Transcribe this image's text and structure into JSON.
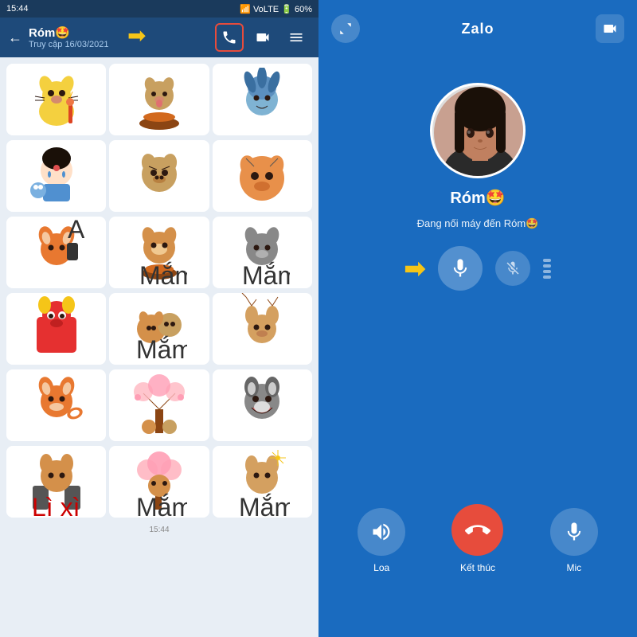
{
  "left": {
    "status_bar": {
      "time": "15:44",
      "battery": "60%",
      "signal": "VoLTE"
    },
    "header": {
      "name": "Róm🤩",
      "sub": "Truy cập 16/03/2021",
      "back_label": "←"
    },
    "stickers": [
      {
        "emoji": "🐕",
        "label": ""
      },
      {
        "emoji": "🦮",
        "label": ""
      },
      {
        "emoji": "🐻",
        "label": ""
      },
      {
        "emoji": "👧",
        "label": ""
      },
      {
        "emoji": "🐶",
        "label": ""
      },
      {
        "emoji": "🐡",
        "label": ""
      },
      {
        "emoji": "🦊",
        "label": "Alo !!!"
      },
      {
        "emoji": "🐕",
        "label": "Mắm mối phúc tài"
      },
      {
        "emoji": "🦝",
        "label": "Mắm mối phúc tài"
      },
      {
        "emoji": "🦁",
        "label": ""
      },
      {
        "emoji": "🐕",
        "label": "Mắm mối phúc tài"
      },
      {
        "emoji": "🦌",
        "label": ""
      },
      {
        "emoji": "🦊",
        "label": ""
      },
      {
        "emoji": "🌸",
        "label": ""
      },
      {
        "emoji": "🐺",
        "label": ""
      },
      {
        "emoji": "🐕",
        "label": "Lì xì nè !!!"
      },
      {
        "emoji": "🌸",
        "label": "Mắm mối phúc tài"
      },
      {
        "emoji": "🐕",
        "label": "Mắm mối phúc tài"
      }
    ],
    "timestamp": "15:44"
  },
  "right": {
    "title": "Zalo",
    "caller_name": "Róm🤩",
    "call_status": "Đang nối máy đến Róm🤩",
    "controls": {
      "speaker_label": "Loa",
      "end_label": "Kết thúc",
      "mic_label": "Mic"
    }
  },
  "icons": {
    "back": "←",
    "phone": "📞",
    "video": "📹",
    "menu": "☰",
    "expand": "⤢",
    "speaker": "🔊",
    "end_call": "📵",
    "mic": "🎙",
    "mute": "🔇",
    "arrows": "↕"
  }
}
